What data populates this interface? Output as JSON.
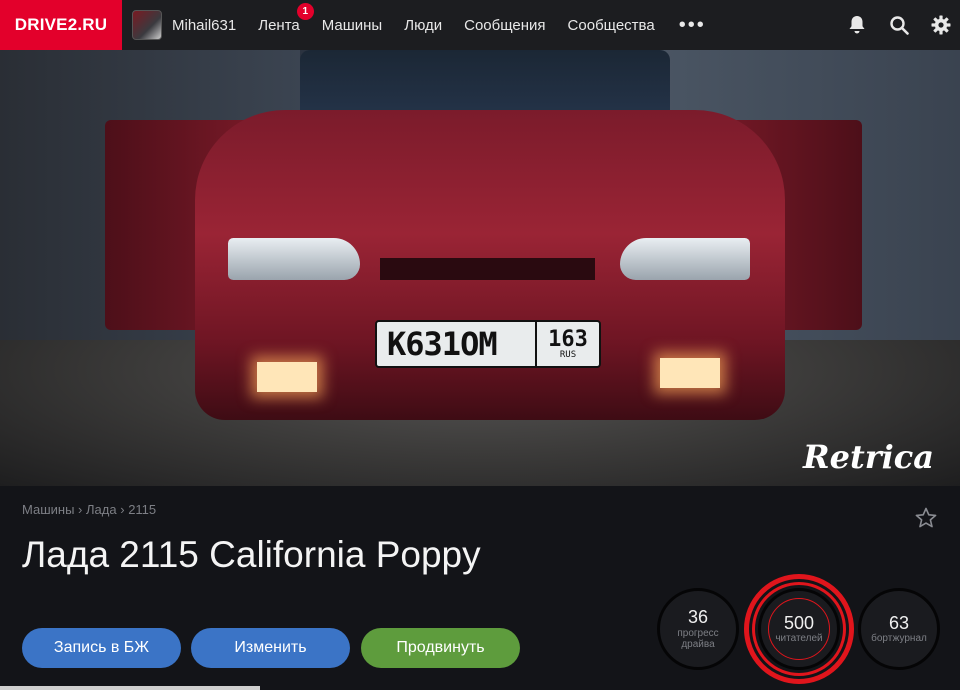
{
  "nav": {
    "logo": "DRIVE2.RU",
    "username": "Mihail631",
    "items": [
      {
        "label": "Лента",
        "badge": "1"
      },
      {
        "label": "Машины"
      },
      {
        "label": "Люди"
      },
      {
        "label": "Сообщения"
      },
      {
        "label": "Сообщества"
      }
    ],
    "more": "•••",
    "icons": [
      "bell-icon",
      "search-icon",
      "gear-icon"
    ]
  },
  "hero": {
    "plate_main": "К631ОМ",
    "plate_region": "163",
    "plate_country": "RUS",
    "watermark": "Retrica"
  },
  "car": {
    "breadcrumb": [
      "Машины",
      "Лада",
      "2115"
    ],
    "breadcrumb_separator": "›",
    "title": "Лада 2115 California Poppy"
  },
  "actions": {
    "log_entry": "Запись в БЖ",
    "edit": "Изменить",
    "promote": "Продвинуть"
  },
  "stats": [
    {
      "value": "36",
      "label": "прогресс драйва"
    },
    {
      "value": "500",
      "label": "читателей"
    },
    {
      "value": "63",
      "label": "бортжурнал"
    }
  ],
  "colors": {
    "brand": "#e3002b",
    "primary_button": "#3b74c6",
    "promote_button": "#5e9c3d",
    "highlight_ring": "#e0151c"
  }
}
